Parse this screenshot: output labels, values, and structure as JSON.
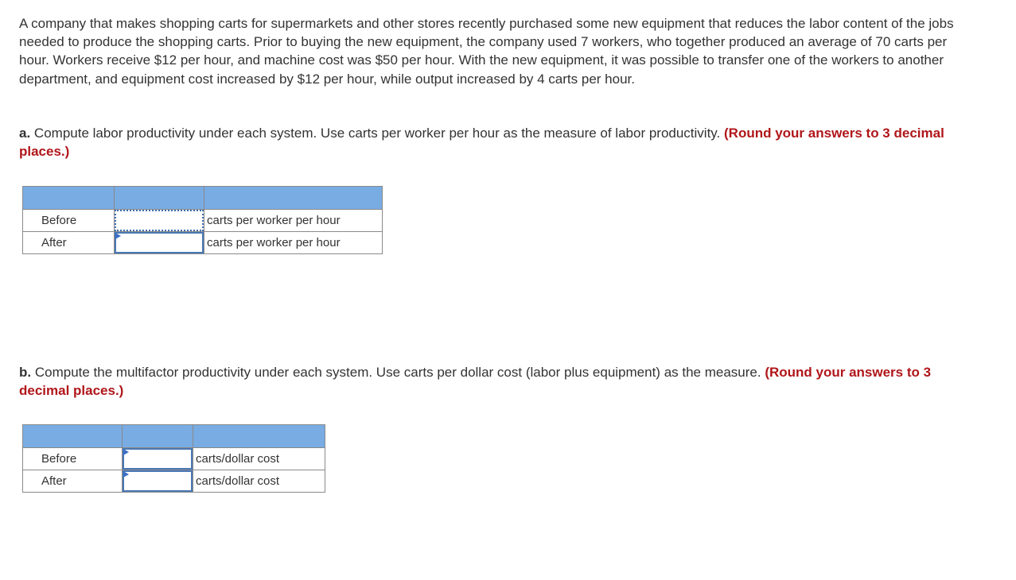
{
  "problem": {
    "intro": "A company that makes shopping carts for supermarkets and other stores recently purchased some new equipment that reduces the labor content of the jobs needed to produce the shopping carts. Prior to buying the new equipment, the company used 7 workers, who together produced an average of 70 carts per hour. Workers receive $12 per hour, and machine cost was $50 per hour. With the new equipment, it was possible to transfer one of the workers to another department, and equipment cost increased by $12 per hour, while output increased by 4 carts per hour."
  },
  "part_a": {
    "letter": "a.",
    "text": "Compute labor productivity under each system. Use carts per worker per hour as the measure of labor productivity.",
    "hint": "(Round your answers to 3 decimal places.)",
    "rows": [
      {
        "label": "Before",
        "value": "",
        "unit": "carts per worker per hour"
      },
      {
        "label": "After",
        "value": "",
        "unit": "carts per worker per hour"
      }
    ]
  },
  "part_b": {
    "letter": "b.",
    "text": "Compute the multifactor productivity under each system. Use carts per dollar cost (labor plus equipment) as the measure.",
    "hint": "(Round your answers to 3 decimal places.)",
    "rows": [
      {
        "label": "Before",
        "value": "",
        "unit": "carts/dollar cost"
      },
      {
        "label": "After",
        "value": "",
        "unit": "carts/dollar cost"
      }
    ]
  },
  "colors": {
    "header_fill": "#79ace3",
    "hint_red": "#b0161a",
    "input_border": "#4a78b5"
  }
}
